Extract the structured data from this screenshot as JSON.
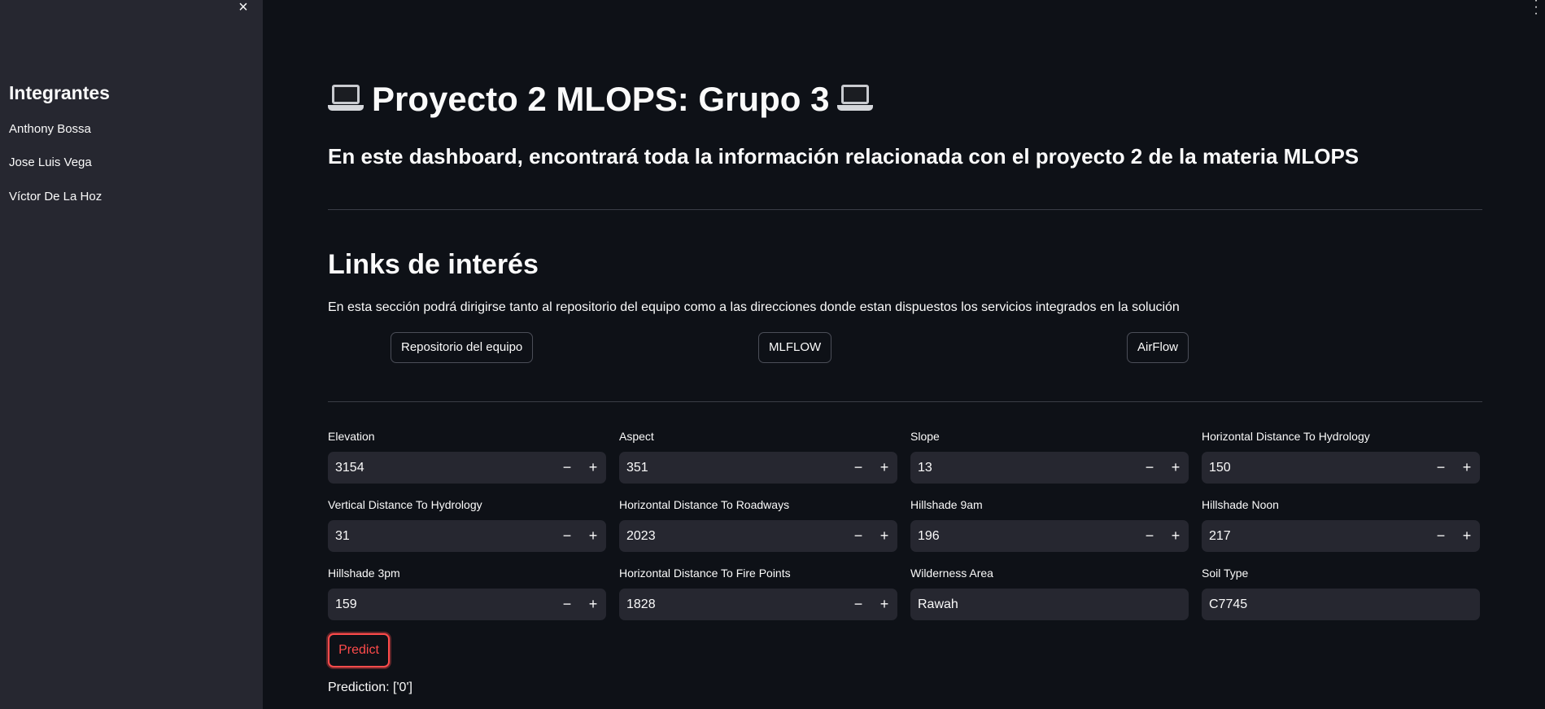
{
  "sidebar": {
    "close_icon": "×",
    "heading": "Integrantes",
    "members": [
      "Anthony Bossa",
      "Jose Luis Vega",
      "Víctor De La Hoz"
    ]
  },
  "header": {
    "title": "Proyecto 2 MLOPS: Grupo 3",
    "title_icon": "laptop-icon",
    "subtitle": "En este dashboard, encontrará toda la información relacionada con el proyecto 2 de la materia MLOPS"
  },
  "links": {
    "heading": "Links de interés",
    "description": "En esta sección podrá dirigirse tanto al repositorio del equipo como a las direcciones donde estan dispuestos los servicios integrados en la solución",
    "buttons": [
      "Repositorio del equipo",
      "MLFLOW",
      "AirFlow"
    ]
  },
  "form": {
    "fields": [
      {
        "label": "Elevation",
        "value": "3154"
      },
      {
        "label": "Aspect",
        "value": "351"
      },
      {
        "label": "Slope",
        "value": "13"
      },
      {
        "label": "Horizontal Distance To Hydrology",
        "value": "150"
      },
      {
        "label": "Vertical Distance To Hydrology",
        "value": "31"
      },
      {
        "label": "Horizontal Distance To Roadways",
        "value": "2023"
      },
      {
        "label": "Hillshade 9am",
        "value": "196"
      },
      {
        "label": "Hillshade Noon",
        "value": "217"
      },
      {
        "label": "Hillshade 3pm",
        "value": "159"
      },
      {
        "label": "Horizontal Distance To Fire Points",
        "value": "1828"
      },
      {
        "label": "Wilderness Area",
        "value": "Rawah"
      },
      {
        "label": "Soil Type",
        "value": "C7745"
      }
    ],
    "minus": "−",
    "plus": "+",
    "predict_label": "Predict",
    "prediction_text": "Prediction: ['0']"
  },
  "colors": {
    "background": "#0e1117",
    "sidebar": "#262730",
    "input_bg": "#262730",
    "accent": "#ff4b4b"
  }
}
